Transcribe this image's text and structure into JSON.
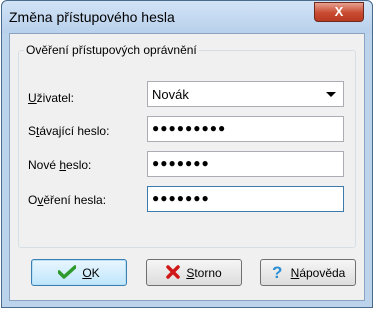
{
  "window": {
    "title": "Změna přístupového hesla",
    "close_label": "X"
  },
  "group": {
    "label": "Ověření přístupových oprávnění"
  },
  "fields": {
    "user_label_pre": "",
    "user_label_u": "U",
    "user_label_post": "živatel:",
    "user_value": "Novák",
    "current_label_pre": "S",
    "current_label_u": "t",
    "current_label_post": "ávající heslo:",
    "current_value": "●●●●●●●●●",
    "new_label_pre": "Nové ",
    "new_label_u": "h",
    "new_label_post": "eslo:",
    "new_value": "●●●●●●●",
    "verify_label_pre": "O",
    "verify_label_u": "v",
    "verify_label_post": "ěření hesla:",
    "verify_value": "●●●●●●●"
  },
  "buttons": {
    "ok_u": "O",
    "ok_post": "K",
    "cancel_u": "S",
    "cancel_post": "torno",
    "help_u": "N",
    "help_post": "ápověda"
  },
  "icons": {
    "ok": "checkmark-icon",
    "cancel": "x-icon",
    "help": "question-mark-icon"
  },
  "colors": {
    "ok_icon": "#2e9a2e",
    "cancel_icon": "#d01818",
    "help_icon": "#2a8fd4"
  }
}
